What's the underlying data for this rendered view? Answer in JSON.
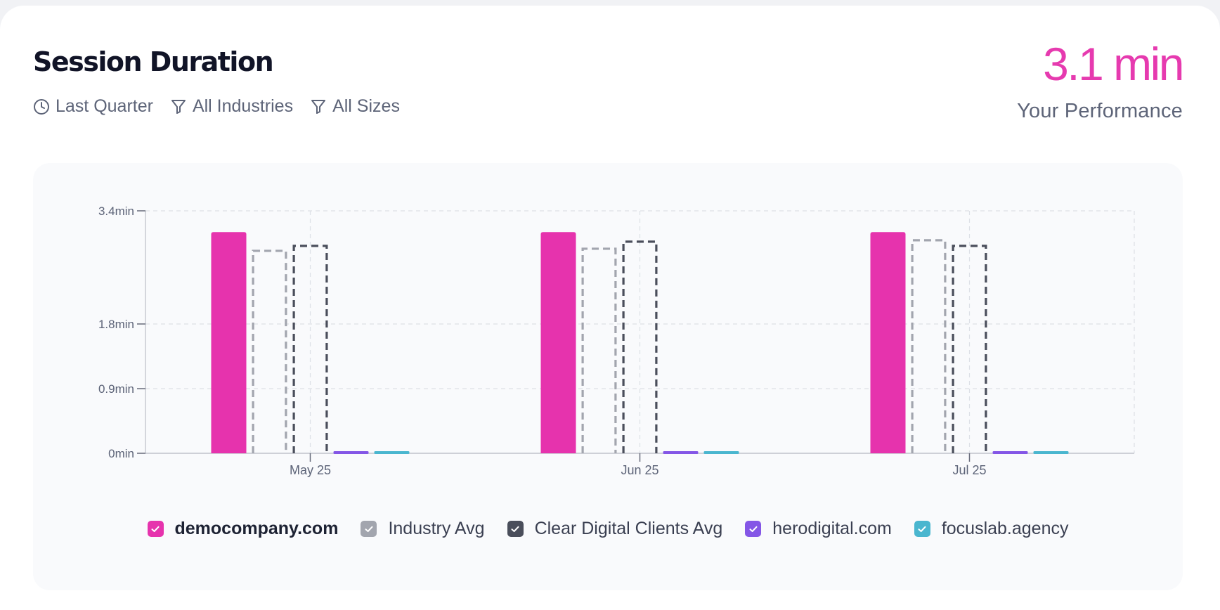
{
  "header": {
    "title": "Session Duration",
    "filters": [
      {
        "icon": "clock-icon",
        "label": "Last Quarter"
      },
      {
        "icon": "filter-icon",
        "label": "All Industries"
      },
      {
        "icon": "filter-icon",
        "label": "All Sizes"
      }
    ]
  },
  "kpi": {
    "value": "3.1 min",
    "label": "Your Performance",
    "color": "#e63aaf"
  },
  "legend": {
    "items": [
      {
        "label": "democompany.com",
        "color": "#e633ad",
        "checked": true
      },
      {
        "label": "Industry Avg",
        "color": "#a2a5ae",
        "checked": true
      },
      {
        "label": "Clear Digital Clients Avg",
        "color": "#4a4e5b",
        "checked": true
      },
      {
        "label": "herodigital.com",
        "color": "#8456e6",
        "checked": true
      },
      {
        "label": "focuslab.agency",
        "color": "#4ab6cf",
        "checked": true
      }
    ]
  },
  "chart_data": {
    "type": "bar",
    "categories": [
      "May 25",
      "Jun 25",
      "Jul 25"
    ],
    "y_ticks": [
      "0min",
      "0.9min",
      "1.8min",
      "3.4min"
    ],
    "y_tick_values": [
      0,
      0.9,
      1.8,
      3.4
    ],
    "ylim": [
      0,
      3.4
    ],
    "grid": true,
    "legend_position": "bottom",
    "series": [
      {
        "name": "democompany.com",
        "values": [
          3.1,
          3.1,
          3.1
        ],
        "color": "#e633ad",
        "style": "solid"
      },
      {
        "name": "Industry Avg",
        "values": [
          2.85,
          2.88,
          3.0
        ],
        "color": "#a2a5ae",
        "style": "dashed"
      },
      {
        "name": "Clear Digital Clients Avg",
        "values": [
          2.92,
          2.98,
          2.92
        ],
        "color": "#4a4e5b",
        "style": "dashed"
      },
      {
        "name": "herodigital.com",
        "values": [
          0,
          0,
          0
        ],
        "color": "#8456e6",
        "style": "solid"
      },
      {
        "name": "focuslab.agency",
        "values": [
          0,
          0,
          0
        ],
        "color": "#4ab6cf",
        "style": "solid"
      }
    ]
  }
}
